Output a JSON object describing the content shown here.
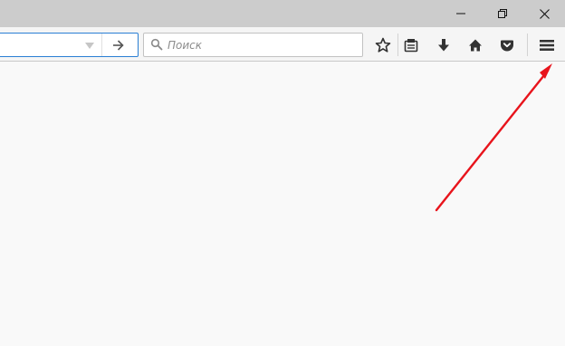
{
  "window_controls": {
    "minimize_icon": "minimize-icon",
    "restore_icon": "restore-icon",
    "close_icon": "close-icon"
  },
  "urlbar": {
    "value": "",
    "dropdown_icon": "dropdown-triangle-icon",
    "go_icon": "arrow-right-icon"
  },
  "search": {
    "placeholder": "Поиск",
    "icon": "magnifier-icon"
  },
  "toolbar_icons": [
    "star-bookmark-icon",
    "reading-list-icon",
    "download-icon",
    "home-icon",
    "pocket-icon",
    "hamburger-menu-icon"
  ],
  "colors": {
    "titlebar": "#cccccc",
    "toolbar": "#f5f5f5",
    "content": "#f9f9f9",
    "urlbar_focus_border": "#2a7fd4",
    "annotation_arrow": "#e8141c"
  }
}
